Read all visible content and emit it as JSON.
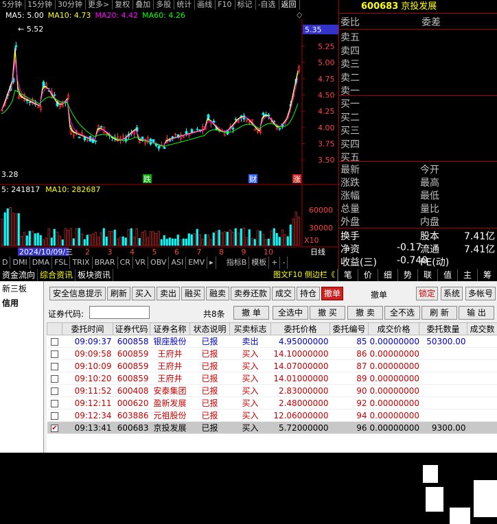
{
  "toolbar": [
    "5分钟",
    "15分钟",
    "30分钟",
    "更多>",
    "复权",
    "叠加",
    "多股",
    "统计",
    "画线",
    "F10",
    "标记",
    "-自选",
    "返回"
  ],
  "chart": {
    "ma_legend": {
      "ma5": "MA5: 5.00",
      "ma10": "MA10: 4.73",
      "ma20": "MA20: 4.42",
      "ma60": "MA60: 4.26"
    },
    "high_label": "5.52",
    "low_label": "3.28",
    "current_price": "5.35",
    "y_ticks": [
      "5.25",
      "5.00",
      "4.75",
      "4.50",
      "4.25",
      "4.00",
      "3.75",
      "3.50"
    ],
    "markers": [
      "跌",
      "财",
      "涨"
    ],
    "vol_legend": {
      "vol": "5: 241817",
      "ma10": "MA10: 282687"
    },
    "vol_ticks": [
      "60000",
      "30000"
    ],
    "vol_unit": "X10",
    "date_label": "2024/10/09/三",
    "month_ticks": [
      "2",
      "3",
      "4",
      "5",
      "6",
      "7",
      "8",
      "9",
      "10"
    ],
    "day_line": "日线",
    "colors": {
      "up": "#ff3232",
      "down": "#00ffff",
      "ma5": "#ffffff",
      "ma10": "#ffff00",
      "ma20": "#ff00ff",
      "ma60": "#00ff00"
    }
  },
  "indicator_tabs": [
    "D",
    "DMI",
    "DMA",
    "FSL",
    "TRIX",
    "BRAR",
    "CR",
    "VR",
    "OBV",
    "ASI",
    "EMV",
    "▸",
    "指标B",
    "模板",
    "+",
    "-"
  ],
  "quote": {
    "code": "600683",
    "name": "京投发展",
    "row1": [
      "委比",
      "委差"
    ],
    "sells": [
      "卖五",
      "卖四",
      "卖三",
      "卖二",
      "卖一"
    ],
    "buys": [
      "买一",
      "买二",
      "买三",
      "买四",
      "买五"
    ],
    "stats_left": [
      "最新",
      "涨跌",
      "涨幅",
      "总量",
      "外盘"
    ],
    "stats_right": [
      "今开",
      "最高",
      "最低",
      "量比",
      "内盘"
    ],
    "bottom": [
      {
        "l": "换手",
        "v1": "",
        "m": "股本",
        "v2": "7.41亿"
      },
      {
        "l": "净资",
        "v1": "-0.17",
        "m": "流通",
        "v2": "7.41亿"
      },
      {
        "l": "收益(三)",
        "v1": "-0.740",
        "m": "PE(动)",
        "v2": ""
      }
    ]
  },
  "nav": {
    "tabs": [
      "资金流向",
      "综合资讯",
      "板块资讯"
    ],
    "extra": "图文F10 侧边栏《",
    "right": [
      "笔",
      "价",
      "细",
      "势",
      "联",
      "值",
      "主",
      "筹"
    ]
  },
  "trade": {
    "left_items": [
      "新三板",
      "信用"
    ],
    "buttons": [
      "安全信息提示",
      "刷新",
      "买入",
      "卖出",
      "融买",
      "融卖",
      "卖券还款",
      "成交",
      "持仓",
      "撤单"
    ],
    "title": "撤单",
    "right_buttons": [
      "锁定",
      "系统",
      "多帐号"
    ],
    "code_label": "证券代码:",
    "count": "共8条",
    "actions": [
      "撤 单",
      "全选中",
      "撤 买",
      "撤 卖",
      "全不选",
      "刷 新",
      "输 出"
    ],
    "headers": [
      "委托时间",
      "证券代码",
      "证券名称",
      "状态说明",
      "买卖标志",
      "委托价格",
      "委托编号",
      "成交价格",
      "委托数量",
      "成交数"
    ],
    "rows": [
      {
        "time": "09:09:37",
        "code": "600858",
        "name": "银座股份",
        "status": "已报",
        "side": "卖出",
        "price": "4.95000000",
        "id": "85",
        "deal": "0.00000000",
        "qty": "50300.00",
        "checked": false,
        "selected": false
      },
      {
        "time": "09:09:58",
        "code": "600859",
        "name": "王府井",
        "status": "已报",
        "side": "买入",
        "price": "14.10000000",
        "id": "86",
        "deal": "0.00000000",
        "qty": "",
        "checked": false,
        "selected": false
      },
      {
        "time": "09:10:09",
        "code": "600859",
        "name": "王府井",
        "status": "已报",
        "side": "买入",
        "price": "14.07000000",
        "id": "87",
        "deal": "0.00000000",
        "qty": "",
        "checked": false,
        "selected": false
      },
      {
        "time": "09:10:20",
        "code": "600859",
        "name": "王府井",
        "status": "已报",
        "side": "买入",
        "price": "14.01000000",
        "id": "89",
        "deal": "0.00000000",
        "qty": "",
        "checked": false,
        "selected": false
      },
      {
        "time": "09:11:52",
        "code": "600408",
        "name": "安泰集团",
        "status": "已报",
        "side": "买入",
        "price": "2.83000000",
        "id": "90",
        "deal": "0.00000000",
        "qty": "",
        "checked": false,
        "selected": false
      },
      {
        "time": "09:12:11",
        "code": "000620",
        "name": "盈新发展",
        "status": "已报",
        "side": "买入",
        "price": "2.48000000",
        "id": "92",
        "deal": "0.00000000",
        "qty": "",
        "checked": false,
        "selected": false
      },
      {
        "time": "09:12:34",
        "code": "603886",
        "name": "元祖股份",
        "status": "已报",
        "side": "买入",
        "price": "12.06000000",
        "id": "94",
        "deal": "0.00000000",
        "qty": "",
        "checked": false,
        "selected": false
      },
      {
        "time": "09:13:41",
        "code": "600683",
        "name": "京投发展",
        "status": "已报",
        "side": "买入",
        "price": "5.72000000",
        "id": "96",
        "deal": "0.00000000",
        "qty": "9300.00",
        "checked": true,
        "selected": true
      }
    ]
  }
}
